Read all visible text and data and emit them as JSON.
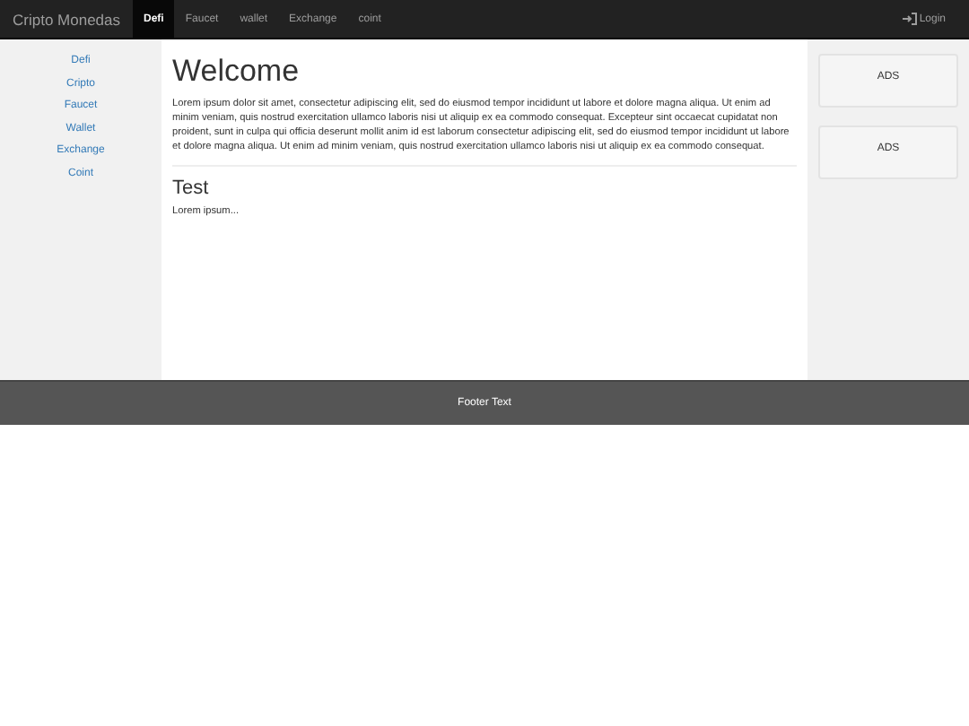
{
  "navbar": {
    "brand": "Cripto Monedas",
    "items": [
      {
        "label": "Defi",
        "selected": true
      },
      {
        "label": "Faucet",
        "selected": false
      },
      {
        "label": "wallet",
        "selected": false
      },
      {
        "label": "Exchange",
        "selected": false
      },
      {
        "label": "coint",
        "selected": false
      }
    ],
    "login": "Login"
  },
  "sidebar": {
    "items": [
      "Defi",
      "Cripto",
      "Faucet",
      "Wallet",
      "Exchange",
      "Coint"
    ]
  },
  "main": {
    "title": "Welcome",
    "paragraph": "Lorem ipsum dolor sit amet, consectetur adipiscing elit, sed do eiusmod tempor incididunt ut labore et dolore magna aliqua. Ut enim ad minim veniam, quis nostrud exercitation ullamco laboris nisi ut aliquip ex ea commodo consequat. Excepteur sint occaecat cupidatat non proident, sunt in culpa qui officia deserunt mollit anim id est laborum consectetur adipiscing elit, sed do eiusmod tempor incididunt ut labore et dolore magna aliqua. Ut enim ad minim veniam, quis nostrud exercitation ullamco laboris nisi ut aliquip ex ea commodo consequat.",
    "subtitle": "Test",
    "subtext": "Lorem ipsum..."
  },
  "ads": [
    "ADS",
    "ADS"
  ],
  "footer": "Footer Text"
}
